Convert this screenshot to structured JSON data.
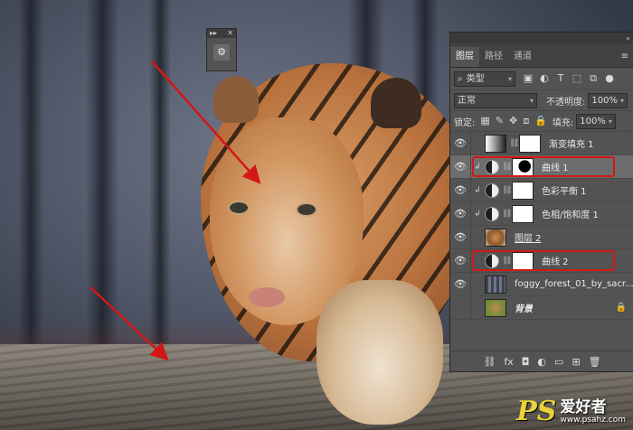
{
  "mini_panel": {
    "collapse_glyph": "▸▸",
    "close_glyph": "✕",
    "icon": "adjustments-icon"
  },
  "layers_panel": {
    "tabs": [
      "图层",
      "路径",
      "通道"
    ],
    "active_tab": "图层",
    "menu_glyph": "≡",
    "filter": {
      "label": "类型",
      "search_glyph": "⌕"
    },
    "blend_mode": "正常",
    "opacity_label": "不透明度:",
    "opacity_value": "100%",
    "lock_label": "锁定:",
    "fill_label": "填充:",
    "fill_value": "100%",
    "layers": [
      {
        "name": "渐变填充 1",
        "visible": true,
        "clipped": false,
        "thumb": "grad",
        "mask": "white",
        "adjustment": false
      },
      {
        "name": "曲线 1",
        "visible": true,
        "clipped": true,
        "thumb": "adj",
        "mask": "mask-black",
        "adjustment": true,
        "selected": true,
        "highlighted": true
      },
      {
        "name": "色彩平衡 1",
        "visible": true,
        "clipped": true,
        "thumb": "adj",
        "mask": "white",
        "adjustment": true
      },
      {
        "name": "色相/饱和度 1",
        "visible": true,
        "clipped": true,
        "thumb": "adj",
        "mask": "white",
        "adjustment": true
      },
      {
        "name": "图层 2",
        "visible": true,
        "clipped": false,
        "thumb": "tiger",
        "mask": "",
        "adjustment": false,
        "underline": true
      },
      {
        "name": "曲线 2",
        "visible": true,
        "clipped": false,
        "thumb": "adj",
        "mask": "white",
        "adjustment": true,
        "highlighted": true
      },
      {
        "name": "foggy_forest_01_by_sacr...",
        "visible": true,
        "clipped": false,
        "thumb": "forest",
        "mask": "",
        "adjustment": false
      },
      {
        "name": "背景",
        "visible": false,
        "clipped": false,
        "thumb": "tiger2",
        "mask": "",
        "adjustment": false,
        "locked": true,
        "italic": true
      }
    ],
    "bottom_icons": [
      "link-layers-icon",
      "fx-icon",
      "add-mask-icon",
      "new-adjustment-icon",
      "new-group-icon",
      "new-layer-icon",
      "delete-icon"
    ],
    "bottom_glyphs": [
      "⛓",
      "fx",
      "◘",
      "◐",
      "▭",
      "⊞",
      "🗑"
    ]
  },
  "watermark": {
    "logo": "PS",
    "title": "爱好者",
    "url": "www.psahz.com"
  },
  "colors": {
    "annotation_red": "#d31717",
    "panel_bg": "#535353"
  }
}
